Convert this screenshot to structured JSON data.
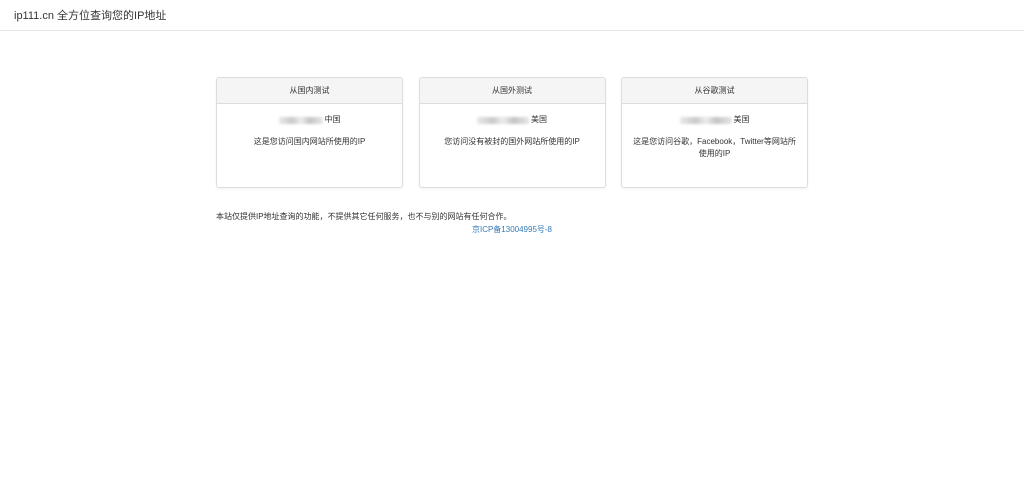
{
  "header": {
    "brand": "ip111.cn 全方位查询您的IP地址"
  },
  "cards": [
    {
      "title": "从国内测试",
      "location": "中国",
      "description": "这是您访问国内网站所使用的IP"
    },
    {
      "title": "从国外测试",
      "location": "美国",
      "description": "您访问没有被封的国外网站所使用的IP"
    },
    {
      "title": "从谷歌测试",
      "location": "美国",
      "description": "这是您访问谷歌，Facebook，Twitter等网站所使用的IP"
    }
  ],
  "footer": {
    "notice": "本站仅提供IP地址查询的功能，不提供其它任何服务，也不与别的网站有任何合作。",
    "icp": "京ICP备13004995号-8"
  }
}
